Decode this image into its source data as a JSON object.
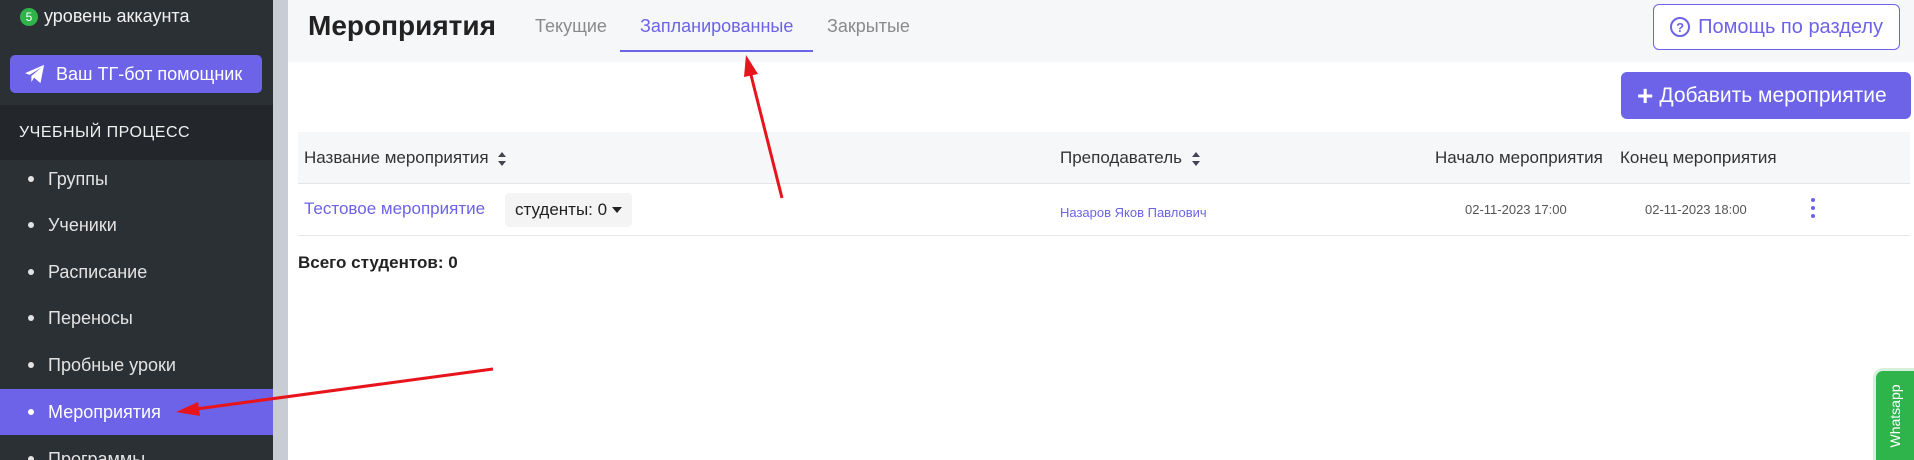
{
  "sidebar": {
    "account_level_badge": "5",
    "account_level_label": "уровень аккаунта",
    "tg_button_label": "Ваш ТГ-бот помощник",
    "section_title": "УЧЕБНЫЙ ПРОЦЕСС",
    "items": [
      {
        "label": "Группы"
      },
      {
        "label": "Ученики"
      },
      {
        "label": "Расписание"
      },
      {
        "label": "Переносы"
      },
      {
        "label": "Пробные уроки"
      },
      {
        "label": "Мероприятия",
        "active": true
      },
      {
        "label": "Программы"
      }
    ]
  },
  "header": {
    "title": "Мероприятия",
    "tabs": [
      {
        "label": "Текущие"
      },
      {
        "label": "Запланированные",
        "active": true
      },
      {
        "label": "Закрытые"
      }
    ],
    "help_button_label": "Помощь по разделу"
  },
  "toolbar": {
    "add_button_label": "Добавить мероприятие"
  },
  "table": {
    "columns": [
      {
        "label": "Название мероприятия",
        "sortable": true
      },
      {
        "label": "Преподаватель",
        "sortable": true
      },
      {
        "label": "Начало мероприятия",
        "sortable": false
      },
      {
        "label": "Конец мероприятия",
        "sortable": false
      }
    ],
    "rows": [
      {
        "name": "Тестовое мероприятие",
        "students_label": "студенты: 0",
        "teacher": "Назаров Яков Павлович",
        "start": "02-11-2023 17:00",
        "end": "02-11-2023 18:00"
      }
    ],
    "total_label": "Всего студентов: 0"
  },
  "widget": {
    "whatsapp_label": "Whatsapp"
  },
  "colors": {
    "accent": "#6c63e8",
    "sidebar_bg": "#2b3035",
    "annotation_arrow": "#e8141b",
    "whatsapp": "#2fb34b"
  }
}
